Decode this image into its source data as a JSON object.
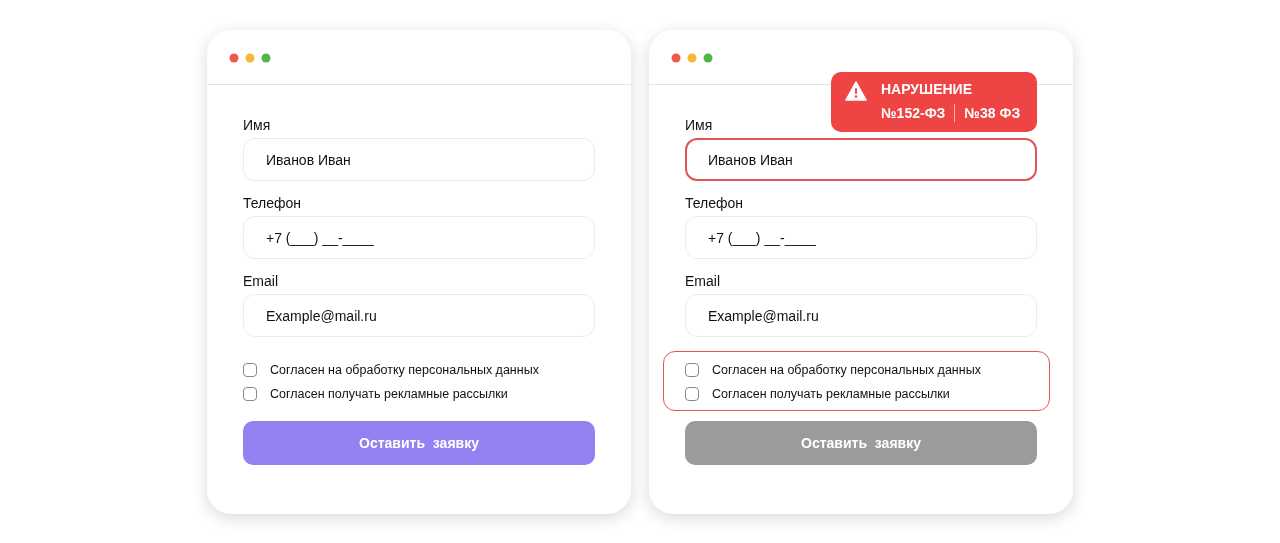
{
  "windows": [
    {
      "fields": [
        {
          "label": "Имя",
          "value": "Иванов Иван",
          "error": false
        },
        {
          "label": "Телефон",
          "value": "+7 (___) __-____",
          "error": false
        },
        {
          "label": "Email",
          "value": "Example@mail.ru",
          "error": false
        }
      ],
      "consents": {
        "error": false,
        "items": [
          {
            "label": "Согласен на обработку персональных данных",
            "checked": false
          },
          {
            "label": "Согласен получать рекламные рассылки",
            "checked": false
          }
        ]
      },
      "submit": {
        "label": "Оставить  заявку",
        "disabled": false
      }
    },
    {
      "violation": {
        "title": "НАРУШЕНИЕ",
        "laws": [
          "№152-ФЗ",
          "№38 ФЗ"
        ]
      },
      "fields": [
        {
          "label": "Имя",
          "value": "Иванов Иван",
          "error": true
        },
        {
          "label": "Телефон",
          "value": "+7 (___) __-____",
          "error": false
        },
        {
          "label": "Email",
          "value": "Example@mail.ru",
          "error": false
        }
      ],
      "consents": {
        "error": true,
        "items": [
          {
            "label": "Согласен на обработку персональных данных",
            "checked": false
          },
          {
            "label": "Согласен получать рекламные рассылки",
            "checked": false
          }
        ]
      },
      "submit": {
        "label": "Оставить  заявку",
        "disabled": true
      }
    }
  ]
}
